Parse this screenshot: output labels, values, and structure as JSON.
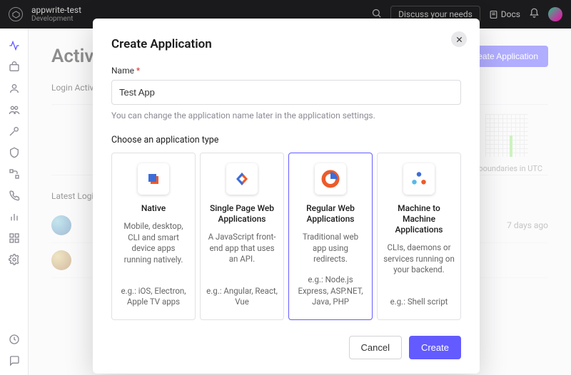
{
  "topbar": {
    "project_name": "appwrite-test",
    "environment": "Development",
    "discuss": "Discuss your needs",
    "docs": "Docs"
  },
  "sidebar": {
    "items": [
      {
        "name": "activity",
        "active": true
      },
      {
        "name": "users"
      },
      {
        "name": "user"
      },
      {
        "name": "org"
      },
      {
        "name": "key"
      },
      {
        "name": "shield"
      },
      {
        "name": "flow"
      },
      {
        "name": "phone"
      },
      {
        "name": "analytics"
      },
      {
        "name": "apps"
      },
      {
        "name": "settings"
      }
    ]
  },
  "main": {
    "title": "Activity",
    "login_activity_label": "Login Activity",
    "latest_logins_label": "Latest Logins",
    "create_button": "Create Application",
    "chart_note": "boundaries in UTC",
    "row_time": "7 days ago"
  },
  "modal": {
    "title": "Create Application",
    "name_label": "Name",
    "name_value": "Test App",
    "helper": "You can change the application name later in the application settings.",
    "type_label": "Choose an application type",
    "types": [
      {
        "title": "Native",
        "desc": "Mobile, desktop, CLI and smart device apps running natively.",
        "example": "e.g.: iOS, Electron, Apple TV apps"
      },
      {
        "title": "Single Page Web Applications",
        "desc": "A JavaScript front-end app that uses an API.",
        "example": "e.g.: Angular, React, Vue"
      },
      {
        "title": "Regular Web Applications",
        "desc": "Traditional web app using redirects.",
        "example": "e.g.: Node.js Express, ASP.NET, Java, PHP"
      },
      {
        "title": "Machine to Machine Applications",
        "desc": "CLIs, daemons or services running on your backend.",
        "example": "e.g.: Shell script"
      }
    ],
    "selected_index": 2,
    "cancel": "Cancel",
    "create": "Create"
  }
}
